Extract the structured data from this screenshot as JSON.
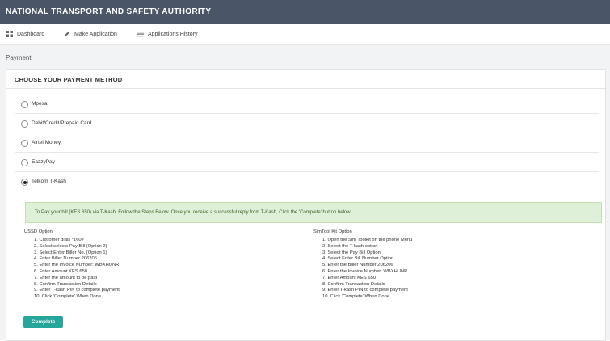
{
  "app": {
    "title": "NATIONAL TRANSPORT AND SAFETY AUTHORITY"
  },
  "nav": {
    "dashboard": {
      "label": "Dashboard",
      "icon": "dashboard-icon"
    },
    "make_application": {
      "label": "Make Application",
      "icon": "pencil-icon"
    },
    "applications_history": {
      "label": "Applications History",
      "icon": "list-icon"
    }
  },
  "page": {
    "breadcrumb": "Payment"
  },
  "payment": {
    "heading": "CHOOSE YOUR PAYMENT METHOD",
    "selected": "Telkom T-Kash",
    "options": [
      {
        "label": "Mpesa",
        "selected": false
      },
      {
        "label": "Debit/Credit/Prepaid Card",
        "selected": false
      },
      {
        "label": "Airtel Money",
        "selected": false
      },
      {
        "label": "EazzyPay",
        "selected": false
      },
      {
        "label": "Telkom T-Kash",
        "selected": true
      }
    ],
    "notice": "To Pay your bill (KES 650) via T-Kash, Follow the Steps Below. Once you receive a successful reply from T-Kash, Click the 'Complete' button below",
    "ussd": {
      "title": "USSD Option",
      "steps": [
        "1. Customer dials *160#",
        "2. Select selects Pay Bill (Option 2)",
        "3. Select Enter Biller No. (Option 1)",
        "4. Enter Biller Number 206206",
        "5. Enter the Invoice Number: WBXHUNR",
        "6. Enter Amount KES 650",
        "7. Enter the amount to be paid",
        "8. Confirm Transaction Details",
        "9. Enter T-kash PIN to complete payment",
        "10. Click 'Complete' When Done"
      ]
    },
    "simtoolkit": {
      "title": "SimTool Kit Option",
      "steps": [
        "1. Open the Sim Toolkit on the phone Menu",
        "2. Select the T-kash option",
        "3. Select the Pay Bill Option",
        "4. Select Enter Bill Number Option",
        "5. Enter the Biller Number 206206",
        "6. Enter the Invoice Number: WBXHUNR",
        "7. Enter Amount KES 650",
        "8. Confirm Transaction Details",
        "9. Enter T-kash PIN to complete payment",
        "10. Click 'Complete' When Done"
      ]
    },
    "complete_label": "Complete"
  },
  "colors": {
    "topbar": "#4a5568",
    "accent": "#26a69a",
    "notice_bg": "#dff0d8"
  }
}
